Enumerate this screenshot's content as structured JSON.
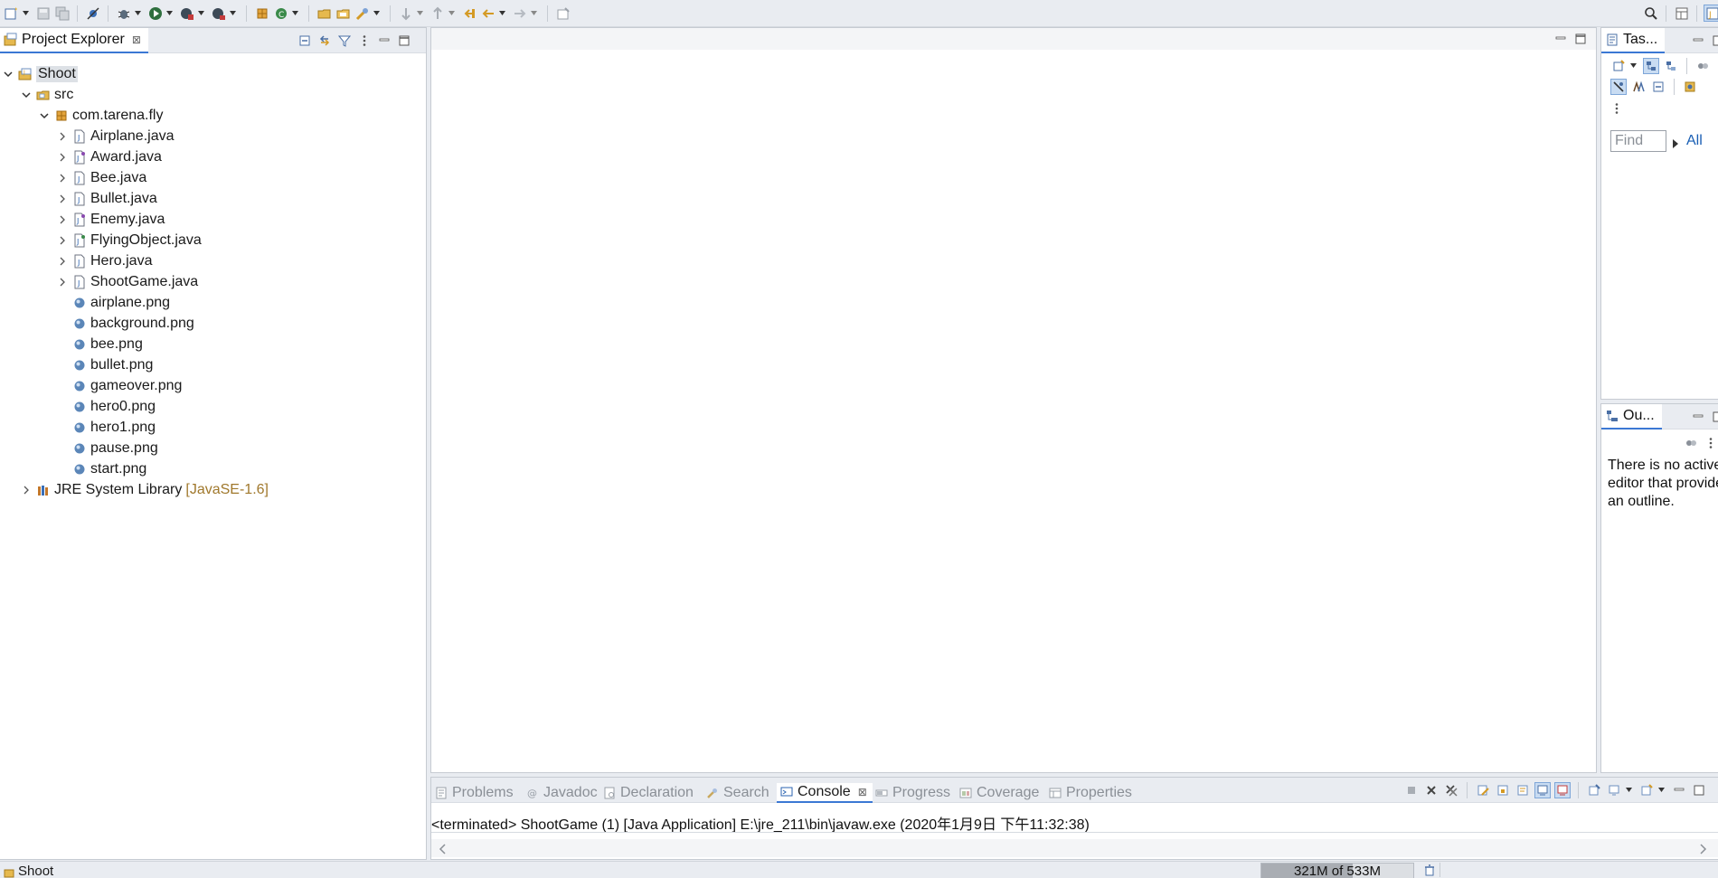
{
  "toolbar": {
    "left_icons": [
      "new-wizard-icon",
      "save-icon",
      "save-all-icon",
      "skip-breakpoints-icon",
      "debug-icon",
      "run-icon",
      "run-coverage-icon",
      "external-tools-icon",
      "new-java-package-icon",
      "new-java-class-icon",
      "open-type-icon",
      "open-task-icon",
      "search-icon",
      "next-annotation-icon",
      "previous-annotation-icon",
      "last-edit-icon",
      "back-icon",
      "forward-icon",
      "pin-editor-icon"
    ],
    "right_icons": [
      "search-icon",
      "open-perspective-icon",
      "java-perspective-icon"
    ]
  },
  "project_explorer": {
    "tab_title": "Project Explorer",
    "tab_close": "⊠",
    "tree": [
      {
        "label": "Shoot",
        "level": 0,
        "expanded": true,
        "icon": "java-project-icon",
        "selected": true
      },
      {
        "label": "src",
        "level": 1,
        "expanded": true,
        "icon": "source-folder-icon"
      },
      {
        "label": "com.tarena.fly",
        "level": 2,
        "expanded": true,
        "icon": "package-icon"
      },
      {
        "label": "Airplane.java",
        "level": 3,
        "expanded": false,
        "icon": "java-file-icon"
      },
      {
        "label": "Award.java",
        "level": 3,
        "expanded": false,
        "icon": "java-interface-file-icon"
      },
      {
        "label": "Bee.java",
        "level": 3,
        "expanded": false,
        "icon": "java-file-icon"
      },
      {
        "label": "Bullet.java",
        "level": 3,
        "expanded": false,
        "icon": "java-file-icon"
      },
      {
        "label": "Enemy.java",
        "level": 3,
        "expanded": false,
        "icon": "java-interface-file-icon"
      },
      {
        "label": "FlyingObject.java",
        "level": 3,
        "expanded": false,
        "icon": "java-abstract-file-icon"
      },
      {
        "label": "Hero.java",
        "level": 3,
        "expanded": false,
        "icon": "java-file-icon"
      },
      {
        "label": "ShootGame.java",
        "level": 3,
        "expanded": false,
        "icon": "java-file-icon"
      },
      {
        "label": "airplane.png",
        "level": 3,
        "icon": "image-file-icon"
      },
      {
        "label": "background.png",
        "level": 3,
        "icon": "image-file-icon"
      },
      {
        "label": "bee.png",
        "level": 3,
        "icon": "image-file-icon"
      },
      {
        "label": "bullet.png",
        "level": 3,
        "icon": "image-file-icon"
      },
      {
        "label": "gameover.png",
        "level": 3,
        "icon": "image-file-icon"
      },
      {
        "label": "hero0.png",
        "level": 3,
        "icon": "image-file-icon"
      },
      {
        "label": "hero1.png",
        "level": 3,
        "icon": "image-file-icon"
      },
      {
        "label": "pause.png",
        "level": 3,
        "icon": "image-file-icon"
      },
      {
        "label": "start.png",
        "level": 3,
        "icon": "image-file-icon"
      },
      {
        "label": "JRE System Library",
        "decoration": "[JavaSE-1.6]",
        "level": 1,
        "expanded": false,
        "icon": "library-icon"
      }
    ]
  },
  "task_list": {
    "tab_title": "Tas...",
    "find_placeholder": "Find",
    "all_link": "All"
  },
  "outline": {
    "tab_title": "Ou...",
    "message": "There is no active editor that provides an outline."
  },
  "bottom_tabs": [
    {
      "label": "Problems",
      "icon": "problems-icon",
      "active": false
    },
    {
      "label": "Javadoc",
      "icon": "javadoc-icon",
      "active": false
    },
    {
      "label": "Declaration",
      "icon": "declaration-icon",
      "active": false
    },
    {
      "label": "Search",
      "icon": "search-view-icon",
      "active": false
    },
    {
      "label": "Console",
      "icon": "console-icon",
      "active": true
    },
    {
      "label": "Progress",
      "icon": "progress-icon",
      "active": false
    },
    {
      "label": "Coverage",
      "icon": "coverage-icon",
      "active": false
    },
    {
      "label": "Properties",
      "icon": "properties-icon",
      "active": false
    }
  ],
  "console": {
    "header": "<terminated> ShootGame (1) [Java Application] E:\\jre_211\\bin\\javaw.exe (2020年1月9日 下午11:32:38)"
  },
  "status_bar": {
    "selection": "Shoot",
    "heap_text": "321M of 533M",
    "heap_used_fraction": 0.602
  },
  "colors": {
    "accent": "#3b78d4",
    "background": "#e9ecf1",
    "panel": "#ffffff",
    "library_decoration": "#a0782c"
  }
}
